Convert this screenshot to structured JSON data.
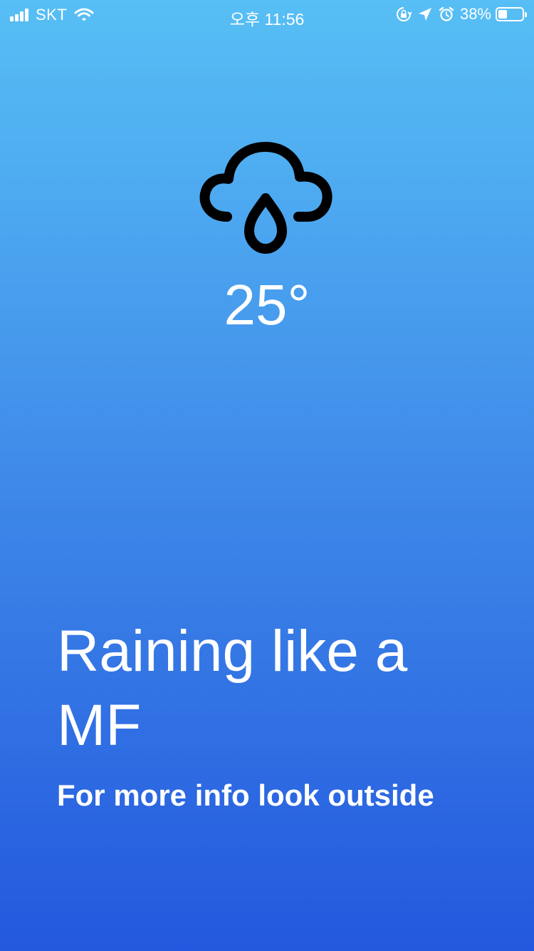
{
  "status_bar": {
    "carrier": "SKT",
    "time": "오후 11:56",
    "battery_percent": "38%",
    "battery_level": 0.38,
    "icons": [
      "signal-icon",
      "wifi-icon",
      "rotation-lock-icon",
      "location-arrow-icon",
      "alarm-icon",
      "battery-icon"
    ]
  },
  "weather": {
    "icon": "rain-cloud-icon",
    "temperature": "25°",
    "headline": "Raining like a MF",
    "subtitle": "For more info look outside"
  },
  "colors": {
    "gradient_top": "#57bff5",
    "gradient_bottom": "#2358de",
    "icon": "#000000",
    "text": "#ffffff"
  }
}
